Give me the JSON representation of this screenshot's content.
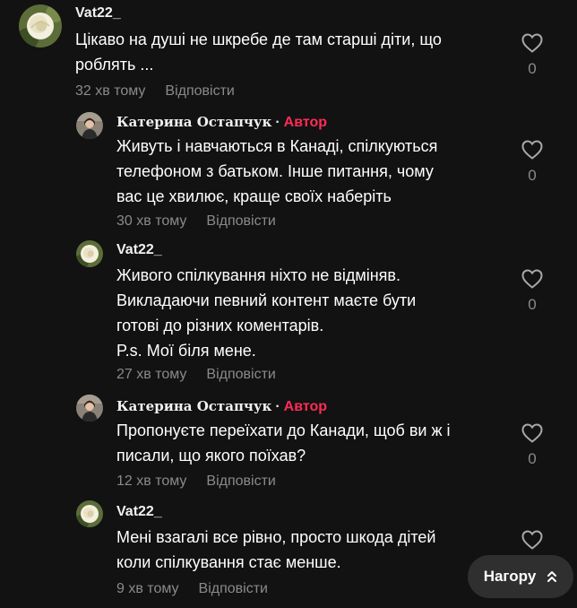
{
  "comments": [
    {
      "author": "Vat22_",
      "text_lines": [
        "Цікаво на душі не шкребе де там старші діти, що",
        "роблять ..."
      ],
      "time": "32 хв тому",
      "reply": "Відповісти",
      "likes": "0"
    },
    {
      "author": "Катерина Остапчук",
      "separator": "·",
      "badge": "Автор",
      "text_lines": [
        "Живуть і навчаються в Канаді, спілкуються",
        "телефоном з батьком. Інше питання, чому",
        "вас це хвилює, краще своїх наберіть"
      ],
      "time": "30 хв тому",
      "reply": "Відповісти",
      "likes": "0"
    },
    {
      "author": "Vat22_",
      "text_lines": [
        "Живого спілкування ніхто не відміняв.",
        "Викладаючи певний контент маєте бути",
        "готові до різних коментарів.",
        "P.s. Мої біля мене."
      ],
      "time": "27 хв тому",
      "reply": "Відповісти",
      "likes": "0"
    },
    {
      "author": "Катерина Остапчук",
      "separator": "·",
      "badge": "Автор",
      "text_lines": [
        "Пропонуєте переїхати до Канади, щоб ви ж і",
        "писали, що якого поїхав?"
      ],
      "time": "12 хв тому",
      "reply": "Відповісти",
      "likes": "0"
    },
    {
      "author": "Vat22_",
      "text_lines": [
        "Мені взагалі все рівно, просто шкода дітей",
        "коли спілкування стає менше."
      ],
      "time": "9 хв тому",
      "reply": "Відповісти"
    }
  ],
  "back_to_top": "Нагору",
  "colors": {
    "background": "#121212",
    "author_badge": "#fe2c55",
    "meta_text": "#8a8a8a",
    "button_bg": "#2f2f2f"
  }
}
